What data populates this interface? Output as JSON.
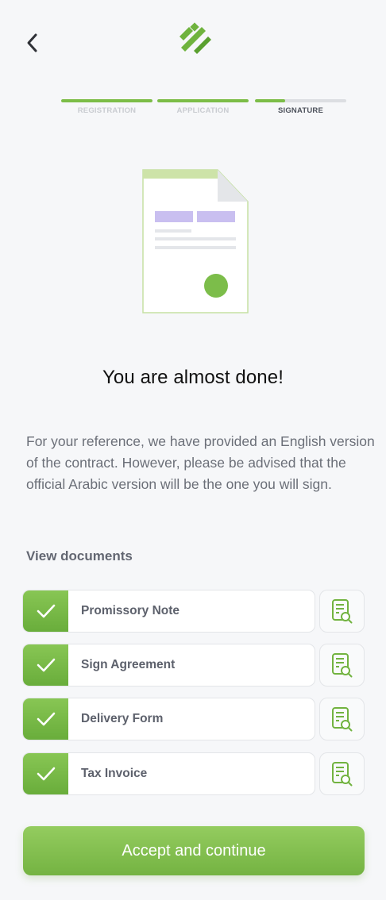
{
  "header": {
    "back_icon": "chevron-left-icon",
    "logo_icon": "brand-logo-icon",
    "brand_color": "#6fb33e"
  },
  "stepper": {
    "steps": [
      {
        "label": "REGISTRATION",
        "progress": 1.0,
        "active": false
      },
      {
        "label": "APPLICATION",
        "progress": 1.0,
        "active": false
      },
      {
        "label": "SIGNATURE",
        "progress": 0.33,
        "active": true
      }
    ]
  },
  "illustration": {
    "icon": "contract-document-illustration"
  },
  "main": {
    "headline": "You are almost done!",
    "info_text": "For your reference, we have provided an English version of the contract. However, please be advised that the official Arabic version will be the one you will sign.",
    "section_title": "View documents"
  },
  "documents": [
    {
      "label": "Promissory Note",
      "checked": true,
      "view_icon": "document-search-icon"
    },
    {
      "label": "Sign Agreement",
      "checked": true,
      "view_icon": "document-search-icon"
    },
    {
      "label": "Delivery Form",
      "checked": true,
      "view_icon": "document-search-icon"
    },
    {
      "label": "Tax Invoice",
      "checked": true,
      "view_icon": "document-search-icon"
    }
  ],
  "footer": {
    "accept_label": "Accept and continue"
  }
}
